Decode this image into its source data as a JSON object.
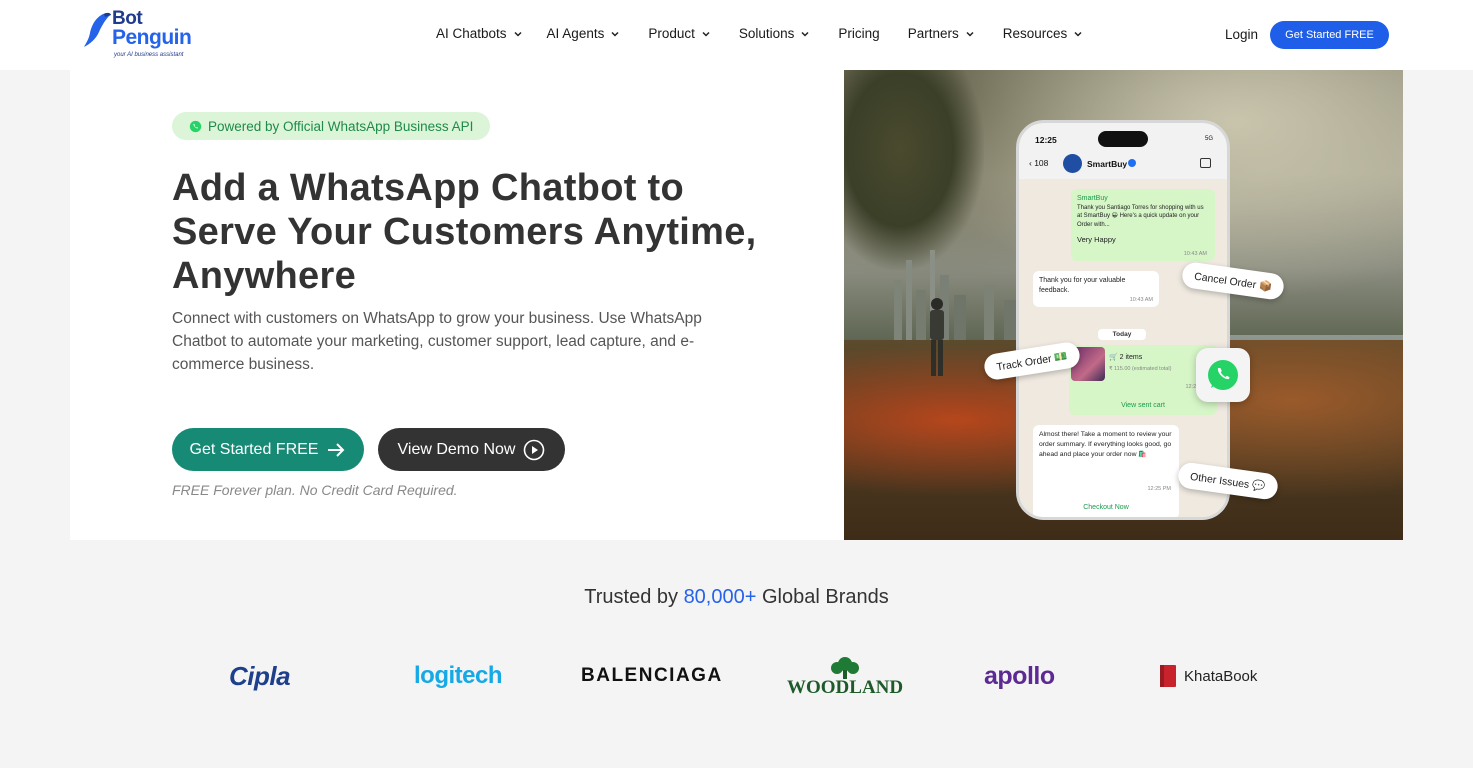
{
  "nav": {
    "logo_line1": "Bot",
    "logo_line2": "Penguin",
    "logo_tagline": "your AI business assistant",
    "menu": [
      {
        "label": "AI Chatbots",
        "has_dropdown": true
      },
      {
        "label": "AI Agents",
        "has_dropdown": true
      },
      {
        "label": "Product",
        "has_dropdown": true
      },
      {
        "label": "Solutions",
        "has_dropdown": true
      },
      {
        "label": "Pricing",
        "has_dropdown": false
      },
      {
        "label": "Partners",
        "has_dropdown": true
      },
      {
        "label": "Resources",
        "has_dropdown": true
      }
    ],
    "login": "Login",
    "cta": "Get Started FREE"
  },
  "hero": {
    "badge": "Powered by Official WhatsApp Business API",
    "title": "Add a WhatsApp Chatbot to Serve Your Customers Anytime, Anywhere",
    "subtitle": "Connect with customers on WhatsApp to grow your business. Use WhatsApp Chatbot to automate your marketing, customer support, lead capture, and e-commerce business.",
    "primary_button": "Get Started FREE",
    "secondary_button": "View Demo Now",
    "note": "FREE Forever plan. No Credit Card Required."
  },
  "phone": {
    "time": "12:25",
    "signal": "5G",
    "back_count": "108",
    "contact_name": "SmartBuy",
    "msg1_sender": "SmartBuy",
    "msg1_text": "Thank you Santiago Torres for shopping with us at SmartBuy 😀 Here's a quick update on your Order with...",
    "msg1_reply": "Very Happy",
    "msg1_time": "10:43 AM",
    "msg2_text": "Thank you for your valuable feedback.",
    "msg2_time": "10:43 AM",
    "day_label": "Today",
    "cart_items": "🛒 2 items",
    "cart_total": "₹ 115.00 (estimated total)",
    "cart_time": "12:25 PM",
    "view_cart": "View sent cart",
    "msg3_text": "Almost there! Take a moment to review your order summary. If everything looks good, go ahead and place your order now 🛍️",
    "msg3_time": "12:25 PM",
    "checkout": "Checkout Now"
  },
  "pills": {
    "cancel": "Cancel Order 📦",
    "track": "Track Order 💵",
    "other": "Other Issues 💬"
  },
  "trusted": {
    "prefix": "Trusted by",
    "number": "80,000+",
    "suffix": "Global Brands"
  },
  "brands": {
    "cipla": "Cipla",
    "logitech": "logitech",
    "balenciaga": "BALENCIAGA",
    "woodland": "WOODLAND",
    "apollo": "apollo",
    "khatabook": "KhataBook"
  },
  "colors": {
    "brand_blue": "#1f5ee8",
    "green_button": "#178a76",
    "dark_button": "#333333",
    "badge_bg": "#dcf5d8"
  }
}
